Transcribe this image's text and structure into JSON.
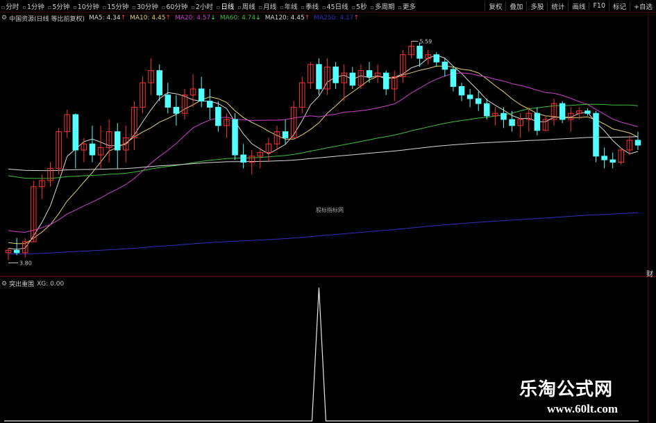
{
  "toolbar": {
    "periods": [
      "分时",
      "1分钟",
      "5分钟",
      "10分钟",
      "15分钟",
      "30分钟",
      "60分钟",
      "2小时",
      "日线",
      "周线",
      "月线",
      "年线",
      "季线",
      "45日线",
      "5秒",
      "多周期",
      "更多"
    ],
    "active_index": 8,
    "right_tools": [
      "复权",
      "叠加",
      "多股",
      "统计",
      "画线",
      "F10",
      "标记",
      "+自选"
    ]
  },
  "legend": {
    "stock_title": "中国资源(日线 等比前复权)",
    "ma": [
      {
        "label": "MA5: 4.34",
        "arrow": "↑",
        "color": "#d8d8d8"
      },
      {
        "label": "MA10: 4.45",
        "arrow": "↑",
        "color": "#e8d070"
      },
      {
        "label": "MA20: 4.57",
        "arrow": "↓",
        "color": "#d040d0"
      },
      {
        "label": "MA60: 4.74",
        "arrow": "↓",
        "color": "#40c040"
      },
      {
        "label": "MA120: 4.45",
        "arrow": "↑",
        "color": "#d8d8d8"
      },
      {
        "label": "MA250: 4.17",
        "arrow": "↑",
        "color": "#3030c0"
      }
    ]
  },
  "annotations": {
    "high": "5.59",
    "low": "3.80",
    "center": "股标指标网",
    "side_label": "财"
  },
  "sub_legend": {
    "name": "突出重围",
    "value": "XG: 0.00"
  },
  "watermark": {
    "cn": "乐淘公式网",
    "url": "www.60lt.com"
  },
  "colors": {
    "up": "#ff3232",
    "down": "#54ffff",
    "ma5": "#d8d8d8",
    "ma10": "#e8d070",
    "ma20": "#d040d0",
    "ma60": "#40c040",
    "ma120": "#d8d8d8",
    "ma250": "#3030c0"
  },
  "chart_data": {
    "type": "candlestick",
    "ohlc": [
      [
        3.86,
        3.9,
        3.8,
        3.88
      ],
      [
        3.88,
        3.98,
        3.84,
        3.86
      ],
      [
        3.86,
        3.98,
        3.82,
        3.95
      ],
      [
        3.95,
        4.45,
        3.95,
        4.4
      ],
      [
        4.4,
        4.5,
        4.3,
        4.45
      ],
      [
        4.45,
        4.6,
        4.4,
        4.55
      ],
      [
        4.55,
        4.88,
        4.5,
        4.85
      ],
      [
        4.85,
        5.03,
        4.8,
        4.99
      ],
      [
        4.99,
        5.0,
        4.55,
        4.7
      ],
      [
        4.7,
        4.8,
        4.6,
        4.75
      ],
      [
        4.75,
        4.9,
        4.6,
        4.66
      ],
      [
        4.66,
        4.9,
        4.55,
        4.72
      ],
      [
        4.72,
        4.95,
        4.6,
        4.85
      ],
      [
        4.85,
        4.92,
        4.55,
        4.7
      ],
      [
        4.7,
        4.9,
        4.6,
        4.8
      ],
      [
        4.8,
        5.1,
        4.7,
        5.05
      ],
      [
        5.05,
        5.3,
        5.0,
        5.25
      ],
      [
        5.25,
        5.45,
        5.15,
        5.35
      ],
      [
        5.35,
        5.4,
        5.1,
        5.15
      ],
      [
        5.15,
        5.25,
        5.0,
        5.05
      ],
      [
        5.05,
        5.15,
        4.9,
        5.0
      ],
      [
        5.0,
        5.2,
        4.95,
        5.15
      ],
      [
        5.15,
        5.32,
        5.05,
        5.2
      ],
      [
        5.2,
        5.3,
        5.05,
        5.1
      ],
      [
        5.1,
        5.2,
        4.95,
        5.05
      ],
      [
        5.05,
        5.1,
        4.85,
        4.9
      ],
      [
        4.9,
        5.0,
        4.8,
        4.95
      ],
      [
        4.95,
        5.0,
        4.62,
        4.66
      ],
      [
        4.66,
        4.75,
        4.55,
        4.6
      ],
      [
        4.6,
        4.7,
        4.5,
        4.65
      ],
      [
        4.65,
        4.72,
        4.55,
        4.68
      ],
      [
        4.68,
        4.8,
        4.6,
        4.75
      ],
      [
        4.75,
        4.9,
        4.7,
        4.85
      ],
      [
        4.85,
        4.95,
        4.75,
        4.8
      ],
      [
        4.8,
        5.1,
        4.8,
        5.05
      ],
      [
        5.05,
        5.3,
        5.0,
        5.25
      ],
      [
        5.25,
        5.42,
        5.2,
        5.4
      ],
      [
        5.4,
        5.45,
        5.15,
        5.2
      ],
      [
        5.2,
        5.45,
        5.15,
        5.38
      ],
      [
        5.38,
        5.42,
        5.2,
        5.25
      ],
      [
        5.25,
        5.4,
        5.1,
        5.33
      ],
      [
        5.33,
        5.38,
        5.2,
        5.23
      ],
      [
        5.23,
        5.4,
        5.2,
        5.35
      ],
      [
        5.35,
        5.42,
        5.25,
        5.3
      ],
      [
        5.3,
        5.4,
        5.25,
        5.33
      ],
      [
        5.33,
        5.35,
        5.15,
        5.2
      ],
      [
        5.2,
        5.35,
        5.1,
        5.3
      ],
      [
        5.3,
        5.52,
        5.25,
        5.48
      ],
      [
        5.48,
        5.59,
        5.45,
        5.55
      ],
      [
        5.55,
        5.58,
        5.38,
        5.45
      ],
      [
        5.45,
        5.52,
        5.4,
        5.48
      ],
      [
        5.48,
        5.5,
        5.38,
        5.42
      ],
      [
        5.42,
        5.45,
        5.3,
        5.36
      ],
      [
        5.36,
        5.38,
        5.18,
        5.22
      ],
      [
        5.22,
        5.25,
        5.1,
        5.15
      ],
      [
        5.15,
        5.2,
        5.05,
        5.12
      ],
      [
        5.12,
        5.18,
        5.02,
        5.08
      ],
      [
        5.08,
        5.12,
        4.95,
        4.98
      ],
      [
        4.98,
        5.05,
        4.9,
        5.0
      ],
      [
        5.0,
        5.05,
        4.88,
        4.95
      ],
      [
        4.95,
        5.02,
        4.85,
        4.9
      ],
      [
        4.9,
        5.0,
        4.8,
        4.95
      ],
      [
        4.95,
        5.05,
        4.85,
        5.0
      ],
      [
        5.0,
        5.05,
        4.82,
        4.86
      ],
      [
        4.86,
        4.98,
        4.86,
        4.95
      ],
      [
        4.95,
        5.12,
        4.9,
        5.08
      ],
      [
        5.08,
        5.1,
        4.92,
        4.95
      ],
      [
        4.95,
        5.05,
        4.85,
        5.0
      ],
      [
        5.0,
        5.05,
        4.95,
        5.02
      ],
      [
        5.02,
        5.04,
        4.98,
        5.0
      ],
      [
        5.0,
        5.02,
        4.6,
        4.65
      ],
      [
        4.65,
        4.72,
        4.55,
        4.62
      ],
      [
        4.62,
        4.68,
        4.55,
        4.6
      ],
      [
        4.6,
        4.72,
        4.58,
        4.7
      ],
      [
        4.7,
        4.82,
        4.66,
        4.78
      ],
      [
        4.78,
        4.85,
        4.7,
        4.74
      ]
    ],
    "ylim": [
      3.7,
      5.7
    ],
    "xg_signal_index": 37,
    "ylabel": ""
  }
}
